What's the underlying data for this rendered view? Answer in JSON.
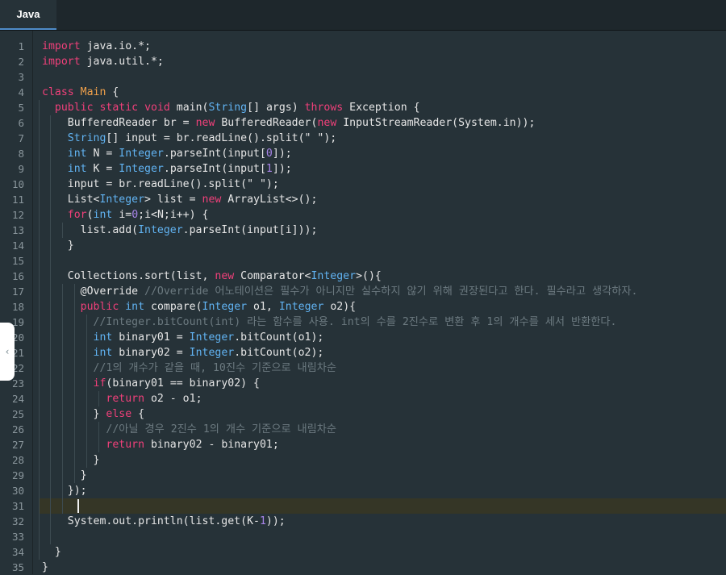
{
  "tab": {
    "label": "Java"
  },
  "collapse_icon": "chevron-left-icon",
  "current_line": 31,
  "lines": [
    [
      [
        "kw2",
        "import"
      ],
      [
        "",
        "·java.io.*;"
      ]
    ],
    [
      [
        "kw2",
        "import"
      ],
      [
        "",
        "·java.util.*;"
      ]
    ],
    [],
    [
      [
        "kw2",
        "class"
      ],
      [
        "",
        "·"
      ],
      [
        "cls",
        "Main"
      ],
      [
        "",
        "·{"
      ]
    ],
    [
      [
        "",
        "··"
      ],
      [
        "kw2",
        "public"
      ],
      [
        "",
        "·"
      ],
      [
        "kw2",
        "static"
      ],
      [
        "",
        "·"
      ],
      [
        "kw2",
        "void"
      ],
      [
        "",
        "·main("
      ],
      [
        "ty",
        "String"
      ],
      [
        "",
        "[]·args)·"
      ],
      [
        "kw2",
        "throws"
      ],
      [
        "",
        "·Exception·{"
      ]
    ],
    [
      [
        "",
        "····BufferedReader·br·=·"
      ],
      [
        "kw2",
        "new"
      ],
      [
        "",
        "·BufferedReader("
      ],
      [
        "kw2",
        "new"
      ],
      [
        "",
        "·InputStreamReader(System.in));"
      ]
    ],
    [
      [
        "",
        "····"
      ],
      [
        "ty",
        "String"
      ],
      [
        "",
        "[]·input·=·br.readLine().split(\"·\");"
      ]
    ],
    [
      [
        "",
        "····"
      ],
      [
        "ty",
        "int"
      ],
      [
        "",
        "·N·=·"
      ],
      [
        "ty",
        "Integer"
      ],
      [
        "",
        ".parseInt(input["
      ],
      [
        "num",
        "0"
      ],
      [
        "",
        "]);"
      ]
    ],
    [
      [
        "",
        "····"
      ],
      [
        "ty",
        "int"
      ],
      [
        "",
        "·K·=·"
      ],
      [
        "ty",
        "Integer"
      ],
      [
        "",
        ".parseInt(input["
      ],
      [
        "num",
        "1"
      ],
      [
        "",
        "]);"
      ]
    ],
    [
      [
        "",
        "····input·=·br.readLine().split(\"·\");"
      ]
    ],
    [
      [
        "",
        "····List<"
      ],
      [
        "ty",
        "Integer"
      ],
      [
        "",
        ">·list·=·"
      ],
      [
        "kw2",
        "new"
      ],
      [
        "",
        "·ArrayList<>();"
      ]
    ],
    [
      [
        "",
        "····"
      ],
      [
        "kw2",
        "for"
      ],
      [
        "",
        "("
      ],
      [
        "ty",
        "int"
      ],
      [
        "",
        "·i="
      ],
      [
        "num",
        "0"
      ],
      [
        "",
        ";i<N;i++)·{"
      ]
    ],
    [
      [
        "",
        "······list.add("
      ],
      [
        "ty",
        "Integer"
      ],
      [
        "",
        ".parseInt(input[i]));"
      ]
    ],
    [
      [
        "",
        "····}"
      ]
    ],
    [],
    [
      [
        "",
        "····Collections.sort(list,·"
      ],
      [
        "kw2",
        "new"
      ],
      [
        "",
        "·Comparator<"
      ],
      [
        "ty",
        "Integer"
      ],
      [
        "",
        ">(){"
      ]
    ],
    [
      [
        "",
        "······@Override·"
      ],
      [
        "cm",
        "//Override·어노테이션은·필수가·아니지만·실수하지·않기·위해·권장된다고·한다.·필수라고·생각하자."
      ]
    ],
    [
      [
        "",
        "······"
      ],
      [
        "kw2",
        "public"
      ],
      [
        "",
        "·"
      ],
      [
        "ty",
        "int"
      ],
      [
        "",
        "·compare("
      ],
      [
        "ty",
        "Integer"
      ],
      [
        "",
        "·o1,·"
      ],
      [
        "ty",
        "Integer"
      ],
      [
        "",
        "·o2){"
      ]
    ],
    [
      [
        "",
        "········"
      ],
      [
        "cm",
        "//Integer.bitCount(int)·라는·함수를·사용.·int의·수를·2진수로·변환·후·1의·개수를·세서·반환한다."
      ]
    ],
    [
      [
        "",
        "········"
      ],
      [
        "ty",
        "int"
      ],
      [
        "",
        "·binary01·=·"
      ],
      [
        "ty",
        "Integer"
      ],
      [
        "",
        ".bitCount(o1);"
      ]
    ],
    [
      [
        "",
        "········"
      ],
      [
        "ty",
        "int"
      ],
      [
        "",
        "·binary02·=·"
      ],
      [
        "ty",
        "Integer"
      ],
      [
        "",
        ".bitCount(o2);"
      ]
    ],
    [
      [
        "",
        "········"
      ],
      [
        "cm",
        "//1의·개수가·같을·때,·10진수·기준으로·내림차순"
      ]
    ],
    [
      [
        "",
        "········"
      ],
      [
        "kw2",
        "if"
      ],
      [
        "",
        "(binary01·==·binary02)·{"
      ]
    ],
    [
      [
        "",
        "··········"
      ],
      [
        "kw2",
        "return"
      ],
      [
        "",
        "·o2·-·o1;"
      ]
    ],
    [
      [
        "",
        "········}·"
      ],
      [
        "kw2",
        "else"
      ],
      [
        "",
        "·{"
      ]
    ],
    [
      [
        "",
        "··········"
      ],
      [
        "cm",
        "//아닐·경우·2진수·1의·개수·기준으로·내림차순"
      ]
    ],
    [
      [
        "",
        "··········"
      ],
      [
        "kw2",
        "return"
      ],
      [
        "",
        "·binary02·-·binary01;"
      ]
    ],
    [
      [
        "",
        "········}"
      ]
    ],
    [
      [
        "",
        "······}"
      ]
    ],
    [
      [
        "",
        "····});"
      ]
    ],
    [],
    [
      [
        "",
        "····System.out.println(list.get(K-"
      ],
      [
        "num",
        "1"
      ],
      [
        "",
        "));"
      ]
    ],
    [],
    [
      [
        "",
        "··}"
      ]
    ],
    [
      [
        "",
        "}"
      ]
    ]
  ]
}
